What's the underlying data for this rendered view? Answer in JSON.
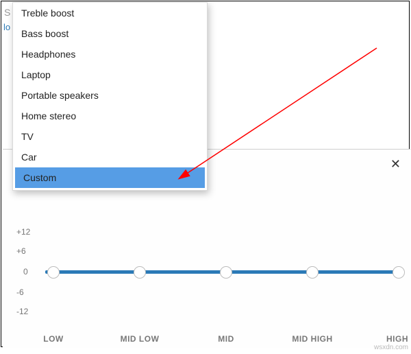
{
  "side_letter": "S",
  "side_cut": "lo",
  "dropdown": {
    "items": [
      {
        "label": "Treble boost",
        "selected": false
      },
      {
        "label": "Bass boost",
        "selected": false
      },
      {
        "label": "Headphones",
        "selected": false
      },
      {
        "label": "Laptop",
        "selected": false
      },
      {
        "label": "Portable speakers",
        "selected": false
      },
      {
        "label": "Home stereo",
        "selected": false
      },
      {
        "label": "TV",
        "selected": false
      },
      {
        "label": "Car",
        "selected": false
      },
      {
        "label": "Custom",
        "selected": true
      }
    ]
  },
  "eq": {
    "close": "✕",
    "y_ticks": [
      "+12",
      "+6",
      "0",
      "-6",
      "-12"
    ],
    "bands": [
      "LOW",
      "MID LOW",
      "MID",
      "MID HIGH",
      "HIGH"
    ]
  },
  "chart_data": {
    "type": "line",
    "title": "",
    "xlabel": "",
    "ylabel": "",
    "ylim": [
      -12,
      12
    ],
    "categories": [
      "LOW",
      "MID LOW",
      "MID",
      "MID HIGH",
      "HIGH"
    ],
    "series": [
      {
        "name": "Custom",
        "values": [
          0,
          0,
          0,
          0,
          0
        ]
      }
    ]
  },
  "watermark": "wsxdn.com"
}
